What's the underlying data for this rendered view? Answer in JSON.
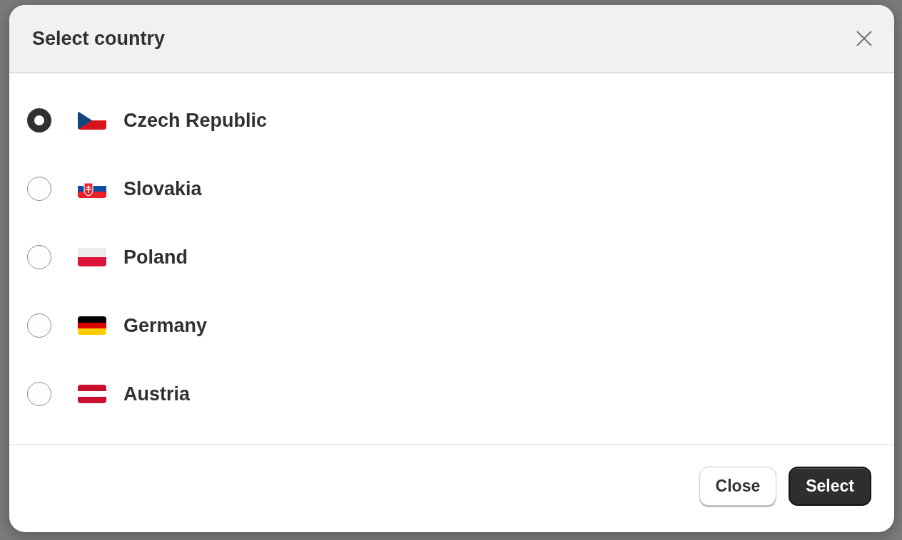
{
  "dialog": {
    "title": "Select country",
    "countries": [
      {
        "name": "Czech Republic",
        "kind": "cz",
        "selected": true
      },
      {
        "name": "Slovakia",
        "kind": "sk",
        "selected": false
      },
      {
        "name": "Poland",
        "kind": "pl",
        "selected": false
      },
      {
        "name": "Germany",
        "kind": "de",
        "selected": false
      },
      {
        "name": "Austria",
        "kind": "at",
        "selected": false
      }
    ],
    "buttons": [
      {
        "label": "Close",
        "kind": "secondary"
      },
      {
        "label": "Select",
        "kind": "primary"
      }
    ]
  }
}
